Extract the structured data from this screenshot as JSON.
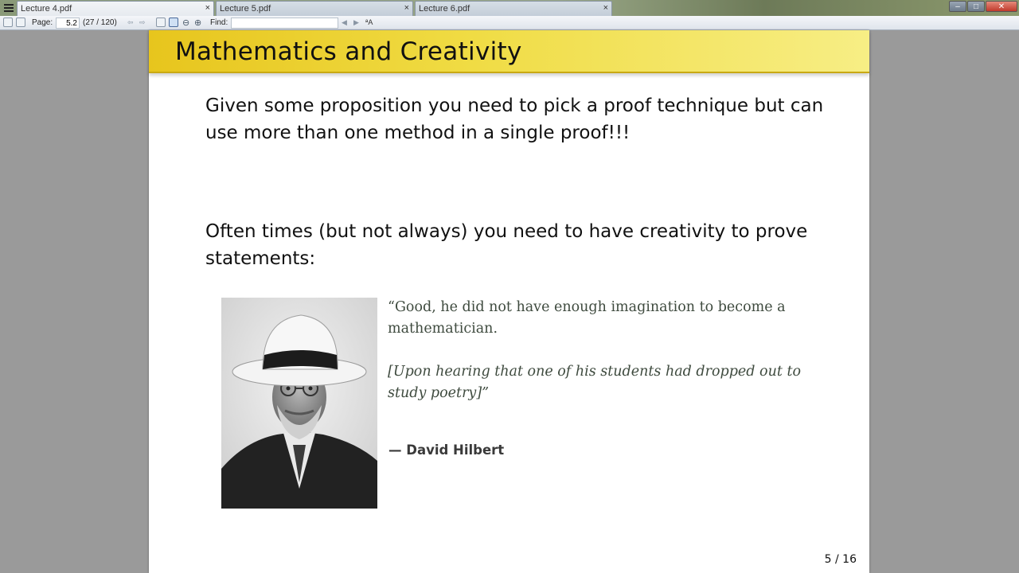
{
  "tabs": [
    {
      "label": "Lecture 4.pdf",
      "close": "×"
    },
    {
      "label": "Lecture 5.pdf",
      "close": "×"
    },
    {
      "label": "Lecture 6.pdf",
      "close": "×"
    }
  ],
  "window_controls": {
    "minimize": "–",
    "maximize": "□",
    "close": "✕"
  },
  "toolbar": {
    "page_label": "Page:",
    "page_value": "5.2",
    "page_count": "(27 / 120)",
    "find_label": "Find:",
    "find_value": "",
    "match_case_glyph": "ªA",
    "prev_glyph": "◀",
    "next_glyph": "▶"
  },
  "slide": {
    "title": "Mathematics and Creativity",
    "paragraph1": "Given some proposition you need to pick a proof technique but can use more than one method in a single proof!!!",
    "paragraph2": "Often times (but not always) you need to have creativity to prove statements:",
    "quote": "“Good, he did not have enough imagination to become a mathematician.",
    "quote_context": "[Upon hearing that one of his students had dropped out to study poetry]”",
    "quote_author": "— David Hilbert",
    "slide_number": "5 / 16"
  },
  "colors": {
    "header_yellow": "#e7c51d",
    "header_light": "#f7ee85",
    "quote_text": "#3e4a3e",
    "viewer_background": "#9a9a9a"
  }
}
